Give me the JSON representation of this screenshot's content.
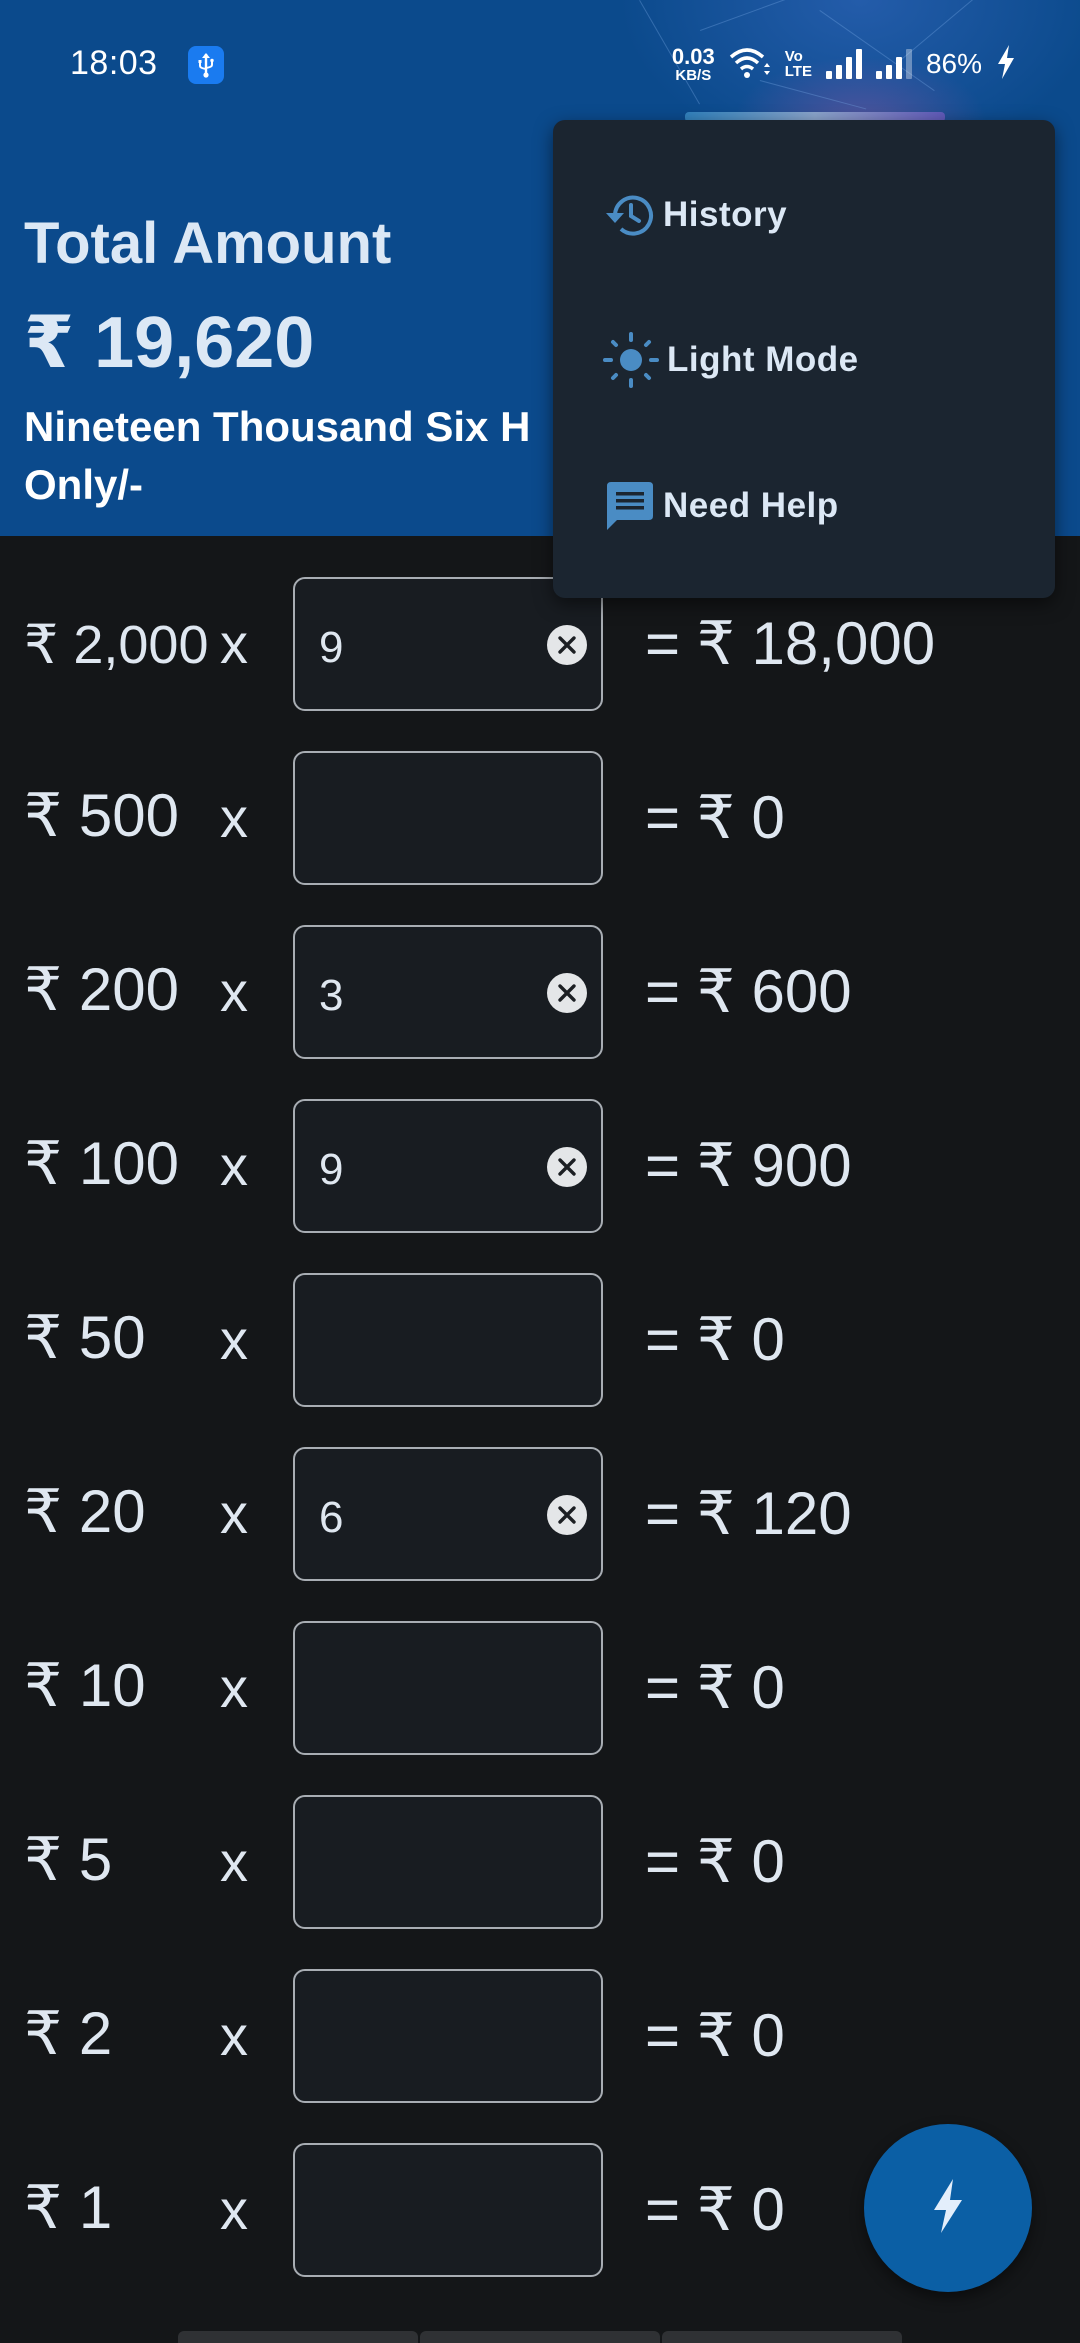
{
  "status_bar": {
    "time": "18:03",
    "usb_icon": "usb-icon",
    "net_speed_value": "0.03",
    "net_speed_unit": "KB/S",
    "volte_top": "Vo",
    "volte_bottom": "LTE",
    "battery": "86%"
  },
  "header": {
    "title": "Total Amount",
    "amount": "₹ 19,620",
    "amount_words_line1": "Nineteen Thousand Six H",
    "amount_words_line2": "Only/-",
    "background_color": "#0b4a8c"
  },
  "menu": {
    "items": [
      {
        "label": "History",
        "icon": "history-icon"
      },
      {
        "label": "Light Mode",
        "icon": "sun-icon"
      },
      {
        "label": "Need Help",
        "icon": "chat-icon"
      }
    ]
  },
  "rows": [
    {
      "denomination": "₹ 2,000",
      "times": "x",
      "quantity": "9",
      "result": "= ₹ 18,000"
    },
    {
      "denomination": "₹ 500",
      "times": "x",
      "quantity": "",
      "result": "= ₹ 0"
    },
    {
      "denomination": "₹ 200",
      "times": "x",
      "quantity": "3",
      "result": "= ₹ 600"
    },
    {
      "denomination": "₹ 100",
      "times": "x",
      "quantity": "9",
      "result": "= ₹ 900"
    },
    {
      "denomination": "₹ 50",
      "times": "x",
      "quantity": "",
      "result": "= ₹ 0"
    },
    {
      "denomination": "₹ 20",
      "times": "x",
      "quantity": "6",
      "result": "= ₹ 120"
    },
    {
      "denomination": "₹ 10",
      "times": "x",
      "quantity": "",
      "result": "= ₹ 0"
    },
    {
      "denomination": "₹ 5",
      "times": "x",
      "quantity": "",
      "result": "= ₹ 0"
    },
    {
      "denomination": "₹ 2",
      "times": "x",
      "quantity": "",
      "result": "= ₹ 0"
    },
    {
      "denomination": "₹ 1",
      "times": "x",
      "quantity": "",
      "result": "= ₹ 0"
    }
  ],
  "fab": {
    "icon": "flash-icon",
    "color": "#0b5fa5"
  },
  "colors": {
    "background": "#141618",
    "menu_bg": "#1b2530",
    "icon_accent": "#4a8cc4",
    "text": "#dfe7f0"
  }
}
